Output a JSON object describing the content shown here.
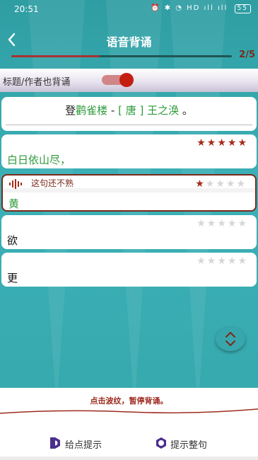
{
  "status_bar": {
    "time": "20:51",
    "icons": "⏰ ✱ ◔ HD ıll ıll",
    "battery": "55"
  },
  "nav": {
    "title": "语音背诵",
    "back_icon": "chevron-left-icon"
  },
  "progress": {
    "current": 2,
    "total": 5,
    "label": "2/5",
    "fill_fraction": 0.4
  },
  "toggle": {
    "label": "标题/作者也背诵",
    "on": true
  },
  "poem_title": {
    "prefix": "登",
    "title": "鹳雀楼",
    "sep1": " - ",
    "dynasty": "[ 唐 ]",
    "author": " 王之涣 ",
    "suffix": "。"
  },
  "lines": [
    {
      "text": "白日依山尽，",
      "stars": 5,
      "state": "done"
    },
    {
      "text": "黄",
      "stars": 1,
      "state": "active",
      "note": "这句还不熟"
    },
    {
      "text": "欲",
      "stars": 0,
      "state": "pending"
    },
    {
      "text": "更",
      "stars": 0,
      "state": "pending"
    }
  ],
  "hint": {
    "text": "点击波纹，暂停背诵。"
  },
  "footer": {
    "hint_point": "给点提示",
    "hint_full": "提示整句"
  },
  "colors": {
    "teal": "#36a9ae",
    "accent": "#a52a1a",
    "green": "#2e9b3c"
  }
}
